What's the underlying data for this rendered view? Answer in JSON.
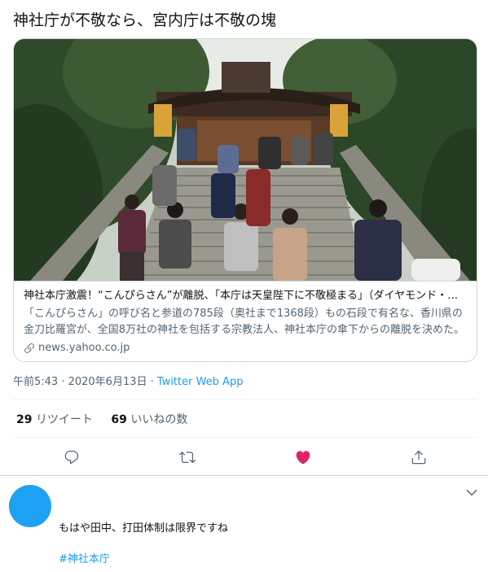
{
  "tweet": {
    "text": "神社庁が不敬なら、宮内庁は不敬の塊",
    "card": {
      "title": "神社本庁激震！“こんぴらさん”が離脱、「本庁は天皇陛下に不敬極まる」（ダイヤモンド・オンライン）",
      "description": "「こんぴらさん」の呼び名と参道の785段（奥社まで1368段）もの石段で有名な、香川県の金刀比羅宮が、全国8万社の神社を包括する宗教法人、神社本庁の傘下からの離脱を決めた。",
      "domain": "news.yahoo.co.jp"
    },
    "meta": {
      "timestamp": "午前5:43 · 2020年6月13日 · ",
      "source": "Twitter Web App"
    },
    "stats": {
      "retweets_count": "29",
      "retweets_label": "リツイート",
      "likes_count": "69",
      "likes_label": "いいねの数"
    },
    "actions": {
      "reply_icon": "reply-icon",
      "retweet_icon": "retweet-icon",
      "like_icon": "heart-filled-icon",
      "share_icon": "share-icon",
      "like_color": "#e0245e",
      "icon_color": "#536471"
    }
  },
  "reply": {
    "avatar_color": "#1da1f2",
    "text": "もはや田中、打田体制は限界ですね",
    "hashtag": "#神社本庁"
  }
}
